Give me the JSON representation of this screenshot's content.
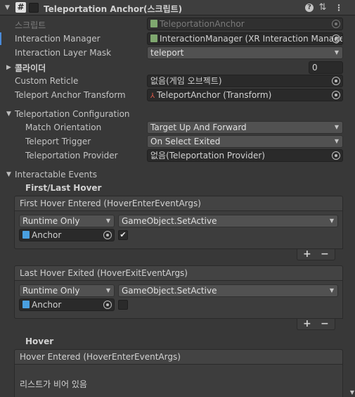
{
  "header": {
    "title": "Teleportation Anchor(스크립트)"
  },
  "fields": {
    "script_label": "스크립트",
    "script_value": "TeleportationAnchor",
    "interaction_manager_label": "Interaction Manager",
    "interaction_manager_value": "InteractionManager (XR Interaction Manager)",
    "interaction_layer_mask_label": "Interaction Layer Mask",
    "interaction_layer_mask_value": "teleport",
    "colliders_label": "콜라이더",
    "colliders_count": "0",
    "custom_reticle_label": "Custom Reticle",
    "custom_reticle_value": "없음(게임 오브젝트)",
    "teleport_anchor_transform_label": "Teleport Anchor Transform",
    "teleport_anchor_transform_value": "TeleportAnchor (Transform)"
  },
  "teleportation_configuration": {
    "label": "Teleportation Configuration",
    "match_orientation_label": "Match Orientation",
    "match_orientation_value": "Target Up And Forward",
    "teleport_trigger_label": "Teleport Trigger",
    "teleport_trigger_value": "On Select Exited",
    "teleportation_provider_label": "Teleportation Provider",
    "teleportation_provider_value": "없음(Teleportation Provider)"
  },
  "interactable_events": {
    "label": "Interactable Events",
    "first_last_hover_label": "First/Last Hover",
    "first_hover_entered": {
      "header": "First Hover Entered (HoverEnterEventArgs)",
      "runtime": "Runtime Only",
      "function": "GameObject.SetActive",
      "object": "Anchor",
      "checked": "✔"
    },
    "last_hover_exited": {
      "header": "Last Hover Exited (HoverExitEventArgs)",
      "runtime": "Runtime Only",
      "function": "GameObject.SetActive",
      "object": "Anchor",
      "checked": ""
    },
    "hover_label": "Hover",
    "hover_entered": {
      "header": "Hover Entered (HoverEnterEventArgs)",
      "empty_text": "리스트가 비어 있음"
    },
    "plus": "+",
    "minus": "−"
  }
}
